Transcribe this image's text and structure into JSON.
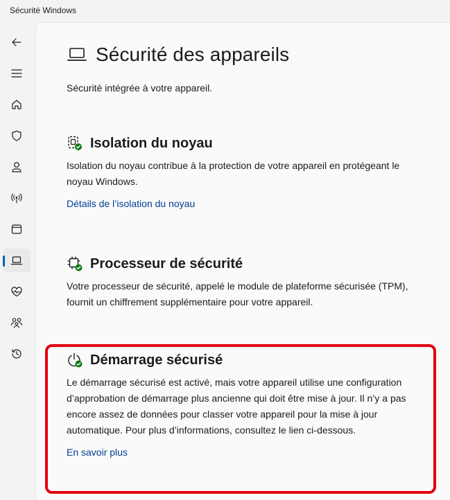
{
  "window": {
    "title": "Sécurité Windows"
  },
  "sidebar": {
    "items": [
      {
        "name": "back",
        "icon": "back-arrow-icon"
      },
      {
        "name": "menu",
        "icon": "hamburger-icon"
      },
      {
        "name": "home",
        "icon": "home-icon"
      },
      {
        "name": "virus-protection",
        "icon": "shield-icon"
      },
      {
        "name": "account-protection",
        "icon": "person-icon"
      },
      {
        "name": "firewall-network",
        "icon": "wireless-icon"
      },
      {
        "name": "app-browser-control",
        "icon": "app-window-icon"
      },
      {
        "name": "device-security",
        "icon": "laptop-icon",
        "selected": true
      },
      {
        "name": "device-performance",
        "icon": "heart-pulse-icon"
      },
      {
        "name": "family-options",
        "icon": "family-icon"
      },
      {
        "name": "protection-history",
        "icon": "history-icon"
      }
    ]
  },
  "page": {
    "title": "Sécurité des appareils",
    "subtitle": "Sécurité intégrée à votre appareil."
  },
  "sections": {
    "core_isolation": {
      "title": "Isolation du noyau",
      "description": "Isolation du noyau contribue à la protection de votre appareil en protégeant le noyau Windows.",
      "link": "Détails de l’isolation du noyau"
    },
    "security_processor": {
      "title": "Processeur de sécurité",
      "description": "Votre processeur de sécurité, appelé le module de plateforme sécurisée (TPM), fournit un chiffrement supplémentaire pour votre appareil."
    },
    "secure_boot": {
      "title": "Démarrage sécurisé",
      "description": "Le démarrage sécurisé est activé, mais votre appareil utilise une configuration d’approbation de démarrage plus ancienne qui doit être mise à jour. Il n’y a pas encore assez de données pour classer votre appareil pour la mise à jour automatique. Pour plus d’informations, consultez le lien ci-dessous.",
      "link": "En savoir plus"
    }
  },
  "colors": {
    "accent": "#005fb8",
    "link": "#003e92",
    "status_ok": "#0f7b0f",
    "highlight": "#e3000f"
  }
}
